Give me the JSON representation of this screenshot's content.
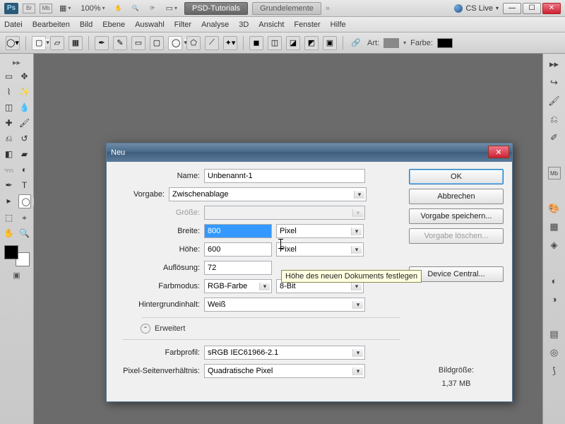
{
  "app": {
    "logo": "Ps",
    "zoom": "100%",
    "tab_active": "PSD-Tutorials",
    "tab_inactive": "Grundelemente",
    "cslive": "CS Live"
  },
  "menu": {
    "items": [
      "Datei",
      "Bearbeiten",
      "Bild",
      "Ebene",
      "Auswahl",
      "Filter",
      "Analyse",
      "3D",
      "Ansicht",
      "Fenster",
      "Hilfe"
    ]
  },
  "options": {
    "art": "Art:",
    "farbe": "Farbe:"
  },
  "dialog": {
    "title": "Neu",
    "name_label": "Name:",
    "name_value": "Unbenannt-1",
    "vorgabe_label": "Vorgabe:",
    "vorgabe_value": "Zwischenablage",
    "groesse_label": "Größe:",
    "breite_label": "Breite:",
    "breite_value": "800",
    "breite_unit": "Pixel",
    "hoehe_label": "Höhe:",
    "hoehe_value": "600",
    "hoehe_unit": "Pixel",
    "aufl_label": "Auflösung:",
    "aufl_value": "72",
    "farbmodus_label": "Farbmodus:",
    "farbmodus_value": "RGB-Farbe",
    "farbtiefe_value": "8-Bit",
    "hintergrund_label": "Hintergrundinhalt:",
    "hintergrund_value": "Weiß",
    "erweitert": "Erweitert",
    "farbprofil_label": "Farbprofil:",
    "farbprofil_value": "sRGB IEC61966-2.1",
    "pixelsv_label": "Pixel-Seitenverhältnis:",
    "pixelsv_value": "Quadratische Pixel",
    "ok": "OK",
    "abbrechen": "Abbrechen",
    "vorgabe_speichern": "Vorgabe speichern...",
    "vorgabe_loeschen": "Vorgabe löschen...",
    "device_central": "Device Central...",
    "bildgroesse_label": "Bildgröße:",
    "bildgroesse_value": "1,37 MB",
    "tooltip": "Höhe des neuen Dokuments festlegen"
  }
}
